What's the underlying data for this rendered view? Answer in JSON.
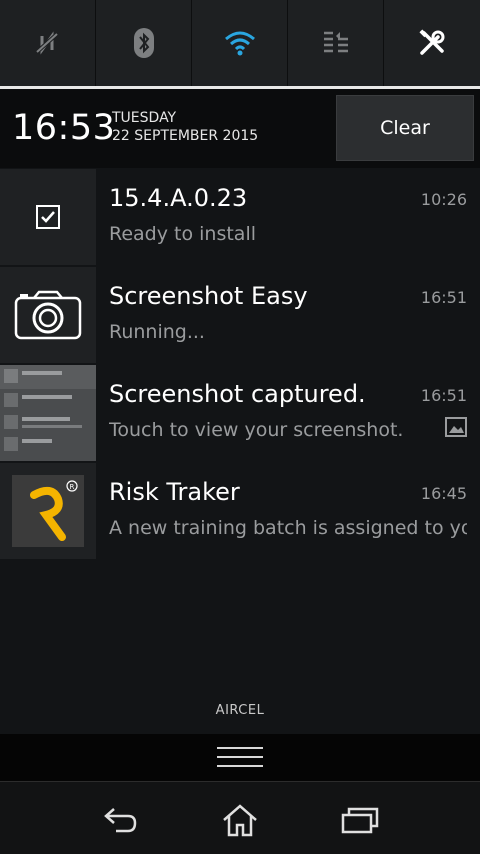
{
  "quick_settings": [
    {
      "icon": "nfc-off-icon",
      "state": "off"
    },
    {
      "icon": "bluetooth-icon",
      "state": "off"
    },
    {
      "icon": "wifi-icon",
      "state": "on"
    },
    {
      "icon": "data-traffic-icon",
      "state": "off"
    },
    {
      "icon": "settings-icon",
      "state": "on"
    }
  ],
  "header": {
    "time": "16:53",
    "day": "TUESDAY",
    "date": "22 SEPTEMBER 2015",
    "clear_label": "Clear"
  },
  "notifications": [
    {
      "icon": "checkbox-icon",
      "title": "15.4.A.0.23",
      "text": "Ready to install",
      "time": "10:26"
    },
    {
      "icon": "camera-icon",
      "title": "Screenshot Easy",
      "text": "Running...",
      "time": "16:51"
    },
    {
      "icon": "screenshot-thumbnail",
      "title": "Screenshot captured.",
      "text": "Touch to view your screenshot.",
      "time": "16:51",
      "sub_icon": "image-icon"
    },
    {
      "icon": "risk-traker-logo",
      "title": "Risk Traker",
      "text": "A new training batch is assigned to you",
      "time": "16:45"
    }
  ],
  "carrier": "AIRCEL",
  "colors": {
    "accent": "#2aa6e0",
    "background": "#121416",
    "tile": "#1f2123"
  }
}
